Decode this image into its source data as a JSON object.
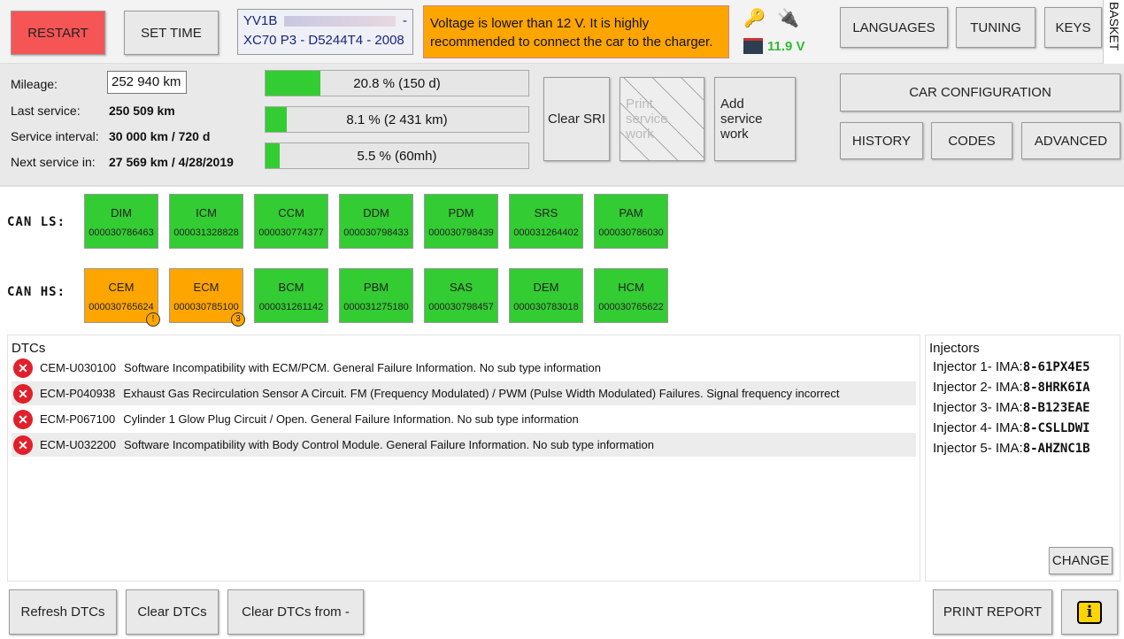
{
  "topbar": {
    "restart": "RESTART",
    "set_time": "SET TIME",
    "vin_prefix": "YV1B",
    "vin_suffix": "-",
    "car_model": "XC70 P3 - D5244T4 - 2008",
    "voltage_warning": "Voltage is lower than 12 V. It is highly recommended to connect the car to the charger.",
    "voltage": "11.9 V",
    "languages": "LANGUAGES",
    "tuning": "TUNING",
    "keys": "KEYS",
    "basket": "BASKET"
  },
  "service": {
    "mileage_label": "Mileage:",
    "mileage_value": "252 940 km",
    "last_label": "Last service:",
    "last_value": "250 509 km",
    "interval_label": "Service interval:",
    "interval_value": "30 000 km / 720 d",
    "next_label": "Next service in:",
    "next_value": "27 569 km / 4/28/2019",
    "bars": [
      {
        "text": "20.8 % (150 d)",
        "percent": 20.8
      },
      {
        "text": "8.1 % (2 431 km)",
        "percent": 8.1
      },
      {
        "text": "5.5 % (60mh)",
        "percent": 5.5
      }
    ],
    "clear_sri": "Clear SRI",
    "print_service": "Print service work",
    "add_service": "Add service work"
  },
  "right_menu": {
    "car_config": "CAR CONFIGURATION",
    "history": "HISTORY",
    "codes": "CODES",
    "advanced": "ADVANCED"
  },
  "can": {
    "ls_label": "CAN LS:",
    "hs_label": "CAN HS:",
    "ls": [
      {
        "name": "DIM",
        "sn": "000030786463",
        "status": "ok"
      },
      {
        "name": "ICM",
        "sn": "000031328828",
        "status": "ok"
      },
      {
        "name": "CCM",
        "sn": "000030774377",
        "status": "ok"
      },
      {
        "name": "DDM",
        "sn": "000030798433",
        "status": "ok"
      },
      {
        "name": "PDM",
        "sn": "000030798439",
        "status": "ok"
      },
      {
        "name": "SRS",
        "sn": "000031264402",
        "status": "ok"
      },
      {
        "name": "PAM",
        "sn": "000030786030",
        "status": "ok"
      }
    ],
    "hs": [
      {
        "name": "CEM",
        "sn": "000030765624",
        "status": "warn",
        "badge": "!"
      },
      {
        "name": "ECM",
        "sn": "000030785100",
        "status": "warn",
        "badge": "3"
      },
      {
        "name": "BCM",
        "sn": "000031261142",
        "status": "ok"
      },
      {
        "name": "PBM",
        "sn": "000031275180",
        "status": "ok"
      },
      {
        "name": "SAS",
        "sn": "000030798457",
        "status": "ok"
      },
      {
        "name": "DEM",
        "sn": "000030783018",
        "status": "ok"
      },
      {
        "name": "HCM",
        "sn": "000030765622",
        "status": "ok"
      }
    ]
  },
  "colors": {
    "ok": "#33cc33",
    "warn": "#ffa500",
    "restart": "#f55555",
    "voltage": "#33bb33"
  },
  "dtcs": {
    "title": "DTCs",
    "items": [
      {
        "code": "CEM-U030100",
        "text": "Software Incompatibility with ECM/PCM.  General Failure Information.  No sub type information"
      },
      {
        "code": "ECM-P040938",
        "text": "Exhaust Gas Recirculation Sensor A Circuit.  FM (Frequency Modulated) / PWM (Pulse Width Modulated) Failures.  Signal frequency incorrect"
      },
      {
        "code": "ECM-P067100",
        "text": "Cylinder 1 Glow Plug Circuit / Open.  General Failure Information.  No sub type information"
      },
      {
        "code": "ECM-U032200",
        "text": "Software Incompatibility with Body Control Module.  General Failure Information.  No sub type information"
      }
    ]
  },
  "injectors": {
    "title": "Injectors",
    "items": [
      {
        "label": "Injector 1- IMA:",
        "code": "8-61PX4E5"
      },
      {
        "label": "Injector 2- IMA:",
        "code": "8-8HRK6IA"
      },
      {
        "label": "Injector 3- IMA:",
        "code": "8-B123EAE"
      },
      {
        "label": "Injector 4- IMA:",
        "code": "8-CSLLDWI"
      },
      {
        "label": "Injector 5- IMA:",
        "code": "8-AHZNC1B"
      }
    ],
    "change": "CHANGE"
  },
  "bottom": {
    "refresh": "Refresh DTCs",
    "clear": "Clear DTCs",
    "clear_from": "Clear DTCs from -",
    "print_report": "PRINT REPORT"
  }
}
